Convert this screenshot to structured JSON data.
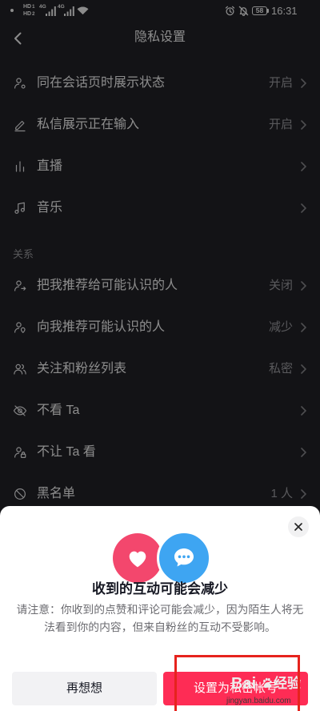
{
  "status_bar": {
    "sim1": {
      "label": "HD",
      "index": "1"
    },
    "sim2": {
      "label": "HD",
      "index": "2"
    },
    "network1": "4G",
    "network2": "4G",
    "battery_level": "58",
    "time": "16:31",
    "icons": [
      "notification-dot",
      "signal-icon",
      "wifi-icon",
      "alarm-icon",
      "mute-bell-icon",
      "battery-icon"
    ]
  },
  "header": {
    "title": "隐私设置",
    "back_icon": "chevron-left-icon"
  },
  "settings": {
    "general": [
      {
        "icon": "user-status-icon",
        "label": "同在会话页时展示状态",
        "value": "开启"
      },
      {
        "icon": "pencil-icon",
        "label": "私信展示正在输入",
        "value": "开启"
      },
      {
        "icon": "live-bars-icon",
        "label": "直播"
      },
      {
        "icon": "music-note-icon",
        "label": "音乐"
      }
    ],
    "relations": {
      "header": "关系",
      "items": [
        {
          "icon": "user-share-icon",
          "label": "把我推荐给可能认识的人",
          "value": "关闭"
        },
        {
          "icon": "user-recommend-icon",
          "label": "向我推荐可能认识的人",
          "value": "减少"
        },
        {
          "icon": "users-icon",
          "label": "关注和粉丝列表",
          "value": "私密"
        },
        {
          "icon": "eye-off-icon",
          "label": "不看 Ta"
        },
        {
          "icon": "user-lock-icon",
          "label": "不让 Ta 看"
        },
        {
          "icon": "block-icon",
          "label": "黑名单",
          "value": "1 人"
        }
      ]
    },
    "row_trailing_icon": "chevron-right-icon"
  },
  "dialog": {
    "close_icon": "close-icon",
    "illustration_icons": [
      "heart-icon",
      "chat-bubble-icon"
    ],
    "title": "收到的互动可能会减少",
    "body": "请注意：你收到的点赞和评论可能会减少，因为陌生人将无法看到你的内容，但来自粉丝的互动不受影响。",
    "cancel_label": "再想想",
    "confirm_label": "设置为私密帐号"
  },
  "watermark": {
    "brand_prefix": "Bai",
    "brand_icon": "paw-icon",
    "brand_suffix": "经验",
    "url": "jingyan.baidu.com"
  },
  "colors": {
    "accent": "#fe2c55",
    "like_circle": "#f3476d",
    "chat_circle": "#3ea5f2",
    "annotation_box": "#e6231d",
    "sheet_background": "#ffffff"
  }
}
